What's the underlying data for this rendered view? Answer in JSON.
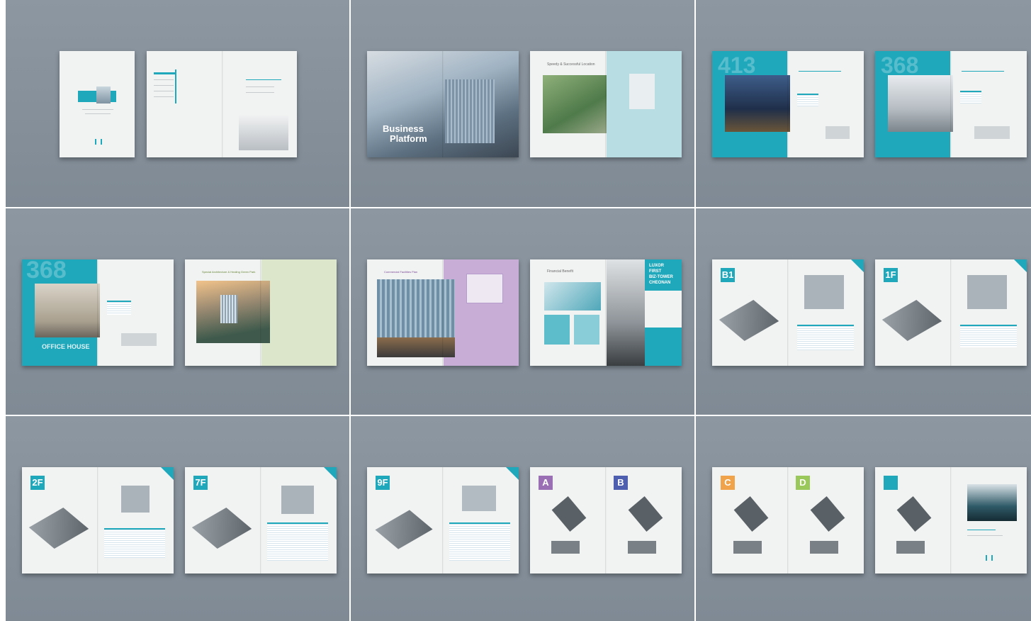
{
  "colors": {
    "background": "#8b96a0",
    "accent_teal": "#1fa7bb",
    "accent_purple": "#c4a7d4",
    "accent_green": "#d7e3c6",
    "accent_orange": "#f0a34a",
    "accent_lime": "#9ac85b"
  },
  "spreads": {
    "s2_business": "Business",
    "s2_platform": "Platform",
    "s2b_title": "Speedy & Successful Location",
    "s3_num": "413",
    "s3b_num": "368",
    "s4_num": "368",
    "s4_office": "OFFICE HOUSE",
    "s4b_title": "Special Architecture & Healing Green Park",
    "s5_title": "Commercial Facilities Plan",
    "s5b_title": "Financial Benefit",
    "s5b_side1": "LUXOR",
    "s5b_side2": "FIRST",
    "s5b_side3": "BIZ-TOWER",
    "s5b_side4": "CHEONAN",
    "f_b1": "B1",
    "f_1f": "1F",
    "f_2f": "2F",
    "f_7f": "7F",
    "f_9f": "9F",
    "t_a": "A",
    "t_b": "B",
    "t_c": "C",
    "t_d": "D"
  }
}
